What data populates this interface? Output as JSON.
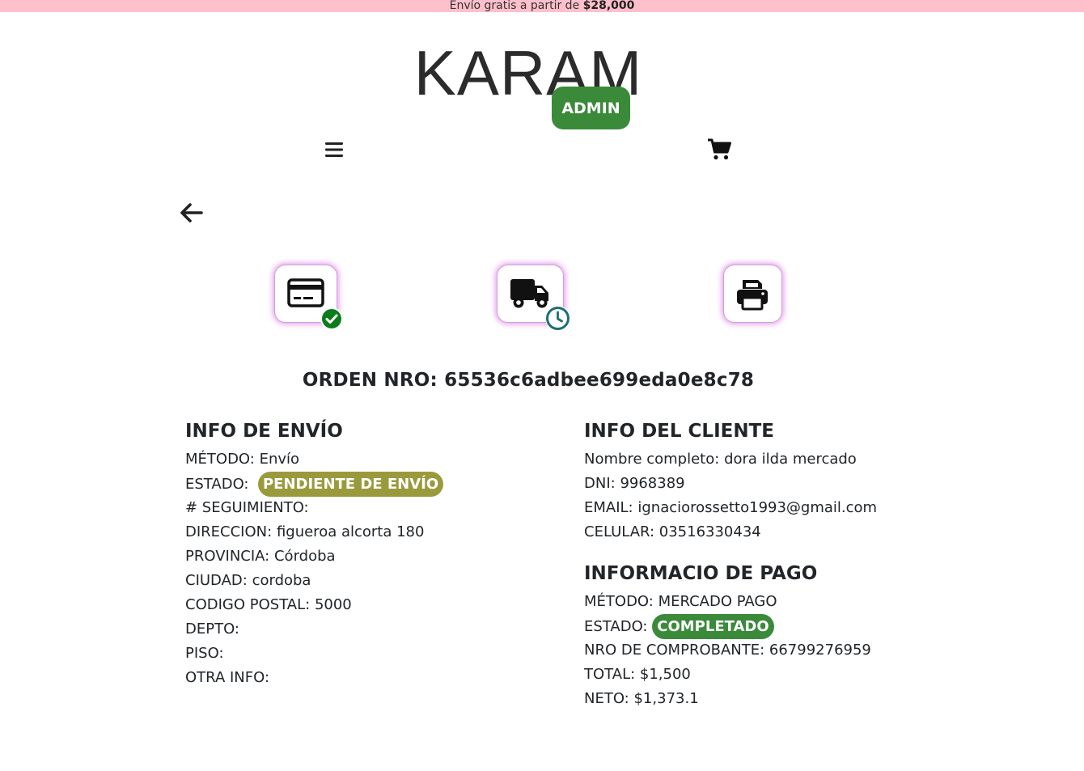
{
  "banner": {
    "text": "Envío gratis a partir de ",
    "amount": "$28,000"
  },
  "header": {
    "logo": "KARAM",
    "admin_label": "ADMIN"
  },
  "icons": {
    "menu": "hamburger-menu-icon",
    "cart": "shopping-cart-icon",
    "back": "arrow-left-icon"
  },
  "steps": [
    {
      "icon": "credit-card-icon",
      "status": "check-circle-icon",
      "status_color": "#008000"
    },
    {
      "icon": "truck-icon",
      "status": "clock-icon",
      "status_color": "#1f6f6f"
    },
    {
      "icon": "printer-icon"
    }
  ],
  "order": {
    "label": "ORDEN NRO:",
    "id": "65536c6adbee699eda0e8c78"
  },
  "shipping": {
    "title": "INFO DE ENVÍO",
    "method_label": "MÉTODO:",
    "method": "Envío",
    "status_label": "ESTADO:",
    "status": "PENDIENTE DE ENVÍO",
    "status_color": "#9a9a3d",
    "tracking_label": "# SEGUIMIENTO:",
    "tracking": "",
    "address_label": "DIRECCION:",
    "address": "figueroa alcorta 180",
    "province_label": "PROVINCIA:",
    "province": "Córdoba",
    "city_label": "CIUDAD:",
    "city": "cordoba",
    "zip_label": "CODIGO POSTAL:",
    "zip": "5000",
    "apt_label": "DEPTO:",
    "apt": "",
    "floor_label": "PISO:",
    "floor": "",
    "other_label": "OTRA INFO:",
    "other": ""
  },
  "client": {
    "title": "INFO DEL CLIENTE",
    "name_label": "Nombre completo:",
    "name": "dora ilda mercado",
    "dni_label": "DNI:",
    "dni": "9968389",
    "email_label": "EMAIL:",
    "email": "ignaciorossetto1993@gmail.com",
    "phone_label": "CELULAR:",
    "phone": "03516330434"
  },
  "payment": {
    "title": "INFORMACIO DE PAGO",
    "method_label": "MÉTODO:",
    "method": "MERCADO PAGO",
    "status_label": "ESTADO:",
    "status": "COMPLETADO",
    "status_color": "#3a8a3a",
    "receipt_label": "NRO DE COMPROBANTE:",
    "receipt": "66799276959",
    "total_label": "TOTAL:",
    "total": "$1,500",
    "net_label": "NETO:",
    "net": "$1,373.1"
  }
}
